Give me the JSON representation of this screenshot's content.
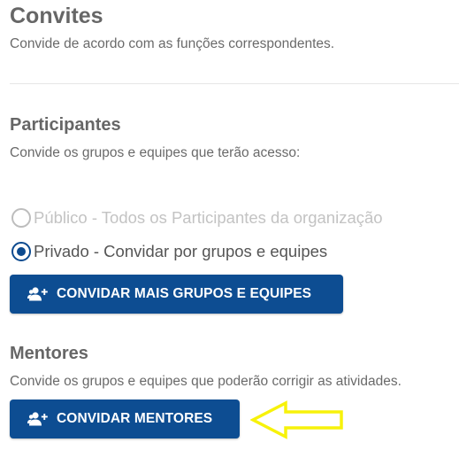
{
  "header": {
    "title": "Convites",
    "subtitle": "Convide de acordo com as funções correspondentes."
  },
  "participants": {
    "title": "Participantes",
    "description": "Convide os grupos e equipes que terão acesso:",
    "options": [
      {
        "label": "Público - Todos os Participantes da organização",
        "selected": false,
        "disabled": true
      },
      {
        "label": "Privado - Convidar por grupos e equipes",
        "selected": true,
        "disabled": false
      }
    ],
    "button_label": "CONVIDAR MAIS GRUPOS E EQUIPES"
  },
  "mentors": {
    "title": "Mentores",
    "description": "Convide os grupos e equipes que poderão corrigir as atividades.",
    "button_label": "CONVIDAR MENTORES"
  },
  "icons": {
    "button_icon": "add-group-icon",
    "annotation": "arrow-left-icon"
  },
  "colors": {
    "primary": "#0d4d92",
    "radio_selected": "#0c4a8f",
    "annotation_arrow": "#f7f20a"
  }
}
